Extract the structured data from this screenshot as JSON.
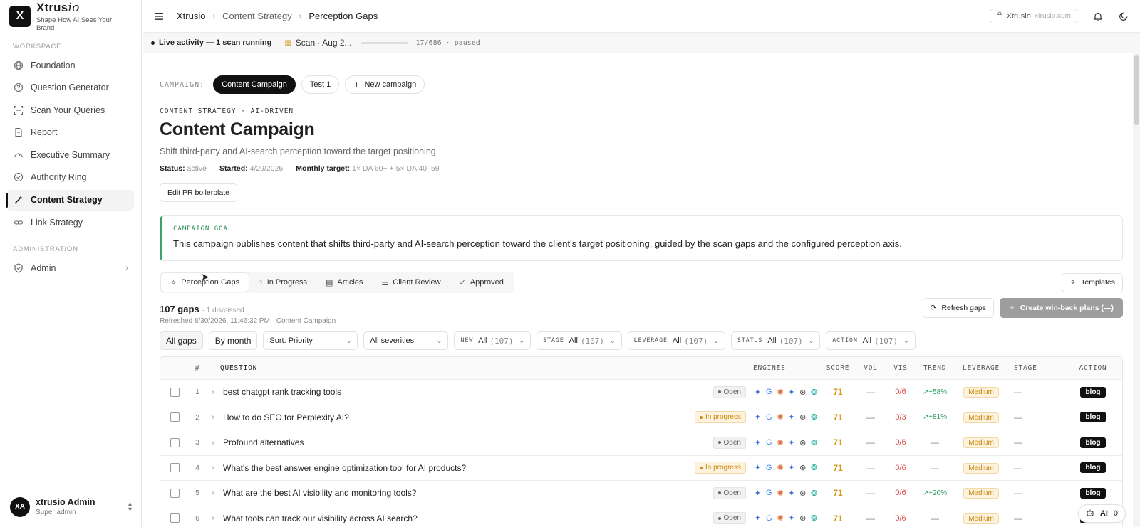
{
  "brand": {
    "logo_letter": "X",
    "name_main": "Xtrus",
    "name_italic": "io",
    "tagline": "Shape How AI Sees Your Brand"
  },
  "sidebar": {
    "workspace_label": "WORKSPACE",
    "items": [
      {
        "label": "Foundation",
        "icon": "globe-icon"
      },
      {
        "label": "Question Generator",
        "icon": "question-icon"
      },
      {
        "label": "Scan Your Queries",
        "icon": "scan-icon"
      },
      {
        "label": "Report",
        "icon": "document-icon"
      },
      {
        "label": "Executive Summary",
        "icon": "gauge-icon"
      },
      {
        "label": "Authority Ring",
        "icon": "check-circle-icon"
      },
      {
        "label": "Content Strategy",
        "icon": "wand-icon",
        "active": true
      },
      {
        "label": "Link Strategy",
        "icon": "link-icon"
      }
    ],
    "admin_section_label": "ADMINISTRATION",
    "admin_item": "Admin",
    "user": {
      "initials": "XA",
      "name": "xtrusio Admin",
      "role": "Super admin"
    }
  },
  "topbar": {
    "crumbs": [
      "Xtrusio",
      "Content Strategy",
      "Perception Gaps"
    ],
    "workspace": "Xtrusio",
    "domain": "xtrusio.com"
  },
  "activity": {
    "live": "Live activity — 1 scan running",
    "scan_label": "Scan · Aug 2...",
    "progress": 0.025,
    "count": "17/686",
    "state": "paused"
  },
  "campaign": {
    "label": "CAMPAIGN:",
    "pills": [
      "Content Campaign",
      "Test 1"
    ],
    "new_label": "New campaign",
    "eyebrow": "CONTENT STRATEGY · AI-DRIVEN",
    "title": "Content Campaign",
    "subtitle": "Shift third-party and AI-search perception toward the target positioning",
    "status_k": "Status:",
    "status_v": "active",
    "started_k": "Started:",
    "started_v": "4/29/2026",
    "target_k": "Monthly target:",
    "target_v": "1× DA 60+ + 5× DA 40–59",
    "edit_btn": "Edit PR boilerplate",
    "goal_k": "CAMPAIGN GOAL",
    "goal_t": "This campaign publishes content that shifts third-party and AI-search perception toward the client's target positioning, guided by the scan gaps and the configured perception axis."
  },
  "tabs": {
    "items": [
      "Perception Gaps",
      "In Progress",
      "Articles",
      "Client Review",
      "Approved"
    ],
    "templates": "Templates"
  },
  "gaps": {
    "count": "107 gaps",
    "dismissed": "· 1 dismissed",
    "refreshed": "Refreshed 8/30/2026, 11:46:32 PM · Content Campaign",
    "refresh_btn": "Refresh gaps",
    "create_btn": "Create win-back plans (—)"
  },
  "filters": {
    "all_gaps": "All gaps",
    "by_month": "By month",
    "sort": "Sort: Priority",
    "severities": "All severities",
    "groups": [
      {
        "cap": "NEW",
        "val": "All",
        "cnt": "(107)"
      },
      {
        "cap": "STAGE",
        "val": "All",
        "cnt": "(107)"
      },
      {
        "cap": "LEVERAGE",
        "val": "All",
        "cnt": "(107)"
      },
      {
        "cap": "STATUS",
        "val": "All",
        "cnt": "(107)"
      },
      {
        "cap": "ACTION",
        "val": "All",
        "cnt": "(107)"
      }
    ]
  },
  "table": {
    "headers": {
      "num": "#",
      "question": "QUESTION",
      "engines": "ENGINES",
      "score": "SCORE",
      "vol": "VOL",
      "vis": "VIS",
      "trend": "TREND",
      "leverage": "LEVERAGE",
      "stage": "STAGE",
      "action": "ACTION"
    },
    "rows": [
      {
        "n": "1",
        "q": "best chatgpt rank tracking tools",
        "status": "Open",
        "score": "71",
        "vol": "—",
        "vis": "0/6",
        "trend": "+58%",
        "lev": "Medium",
        "stage": "—",
        "act": "blog"
      },
      {
        "n": "2",
        "q": "How to do SEO for Perplexity AI?",
        "status": "In progress",
        "score": "71",
        "vol": "—",
        "vis": "0/3",
        "trend": "+81%",
        "lev": "Medium",
        "stage": "—",
        "act": "blog"
      },
      {
        "n": "3",
        "q": "Profound alternatives",
        "status": "Open",
        "score": "71",
        "vol": "—",
        "vis": "0/6",
        "trend": "—",
        "lev": "Medium",
        "stage": "—",
        "act": "blog"
      },
      {
        "n": "4",
        "q": "What's the best answer engine optimization tool for AI products?",
        "status": "In progress",
        "score": "71",
        "vol": "—",
        "vis": "0/6",
        "trend": "—",
        "lev": "Medium",
        "stage": "—",
        "act": "blog"
      },
      {
        "n": "5",
        "q": "What are the best AI visibility and monitoring tools?",
        "status": "Open",
        "score": "71",
        "vol": "—",
        "vis": "0/6",
        "trend": "+20%",
        "lev": "Medium",
        "stage": "—",
        "act": "blog"
      },
      {
        "n": "6",
        "q": "What tools can track our visibility across AI search?",
        "status": "Open",
        "score": "71",
        "vol": "—",
        "vis": "0/6",
        "trend": "—",
        "lev": "Medium",
        "stage": "—",
        "act": "blog"
      }
    ],
    "engines": [
      "✦",
      "G",
      "✺",
      "✦",
      "⊛",
      "❂"
    ],
    "engine_colors": [
      "#3b6fd8",
      "#4285f4",
      "#e0703a",
      "#3b6fd8",
      "#444444",
      "#2bb3a3"
    ]
  },
  "ai_float": {
    "label": "AI",
    "count": "0"
  }
}
